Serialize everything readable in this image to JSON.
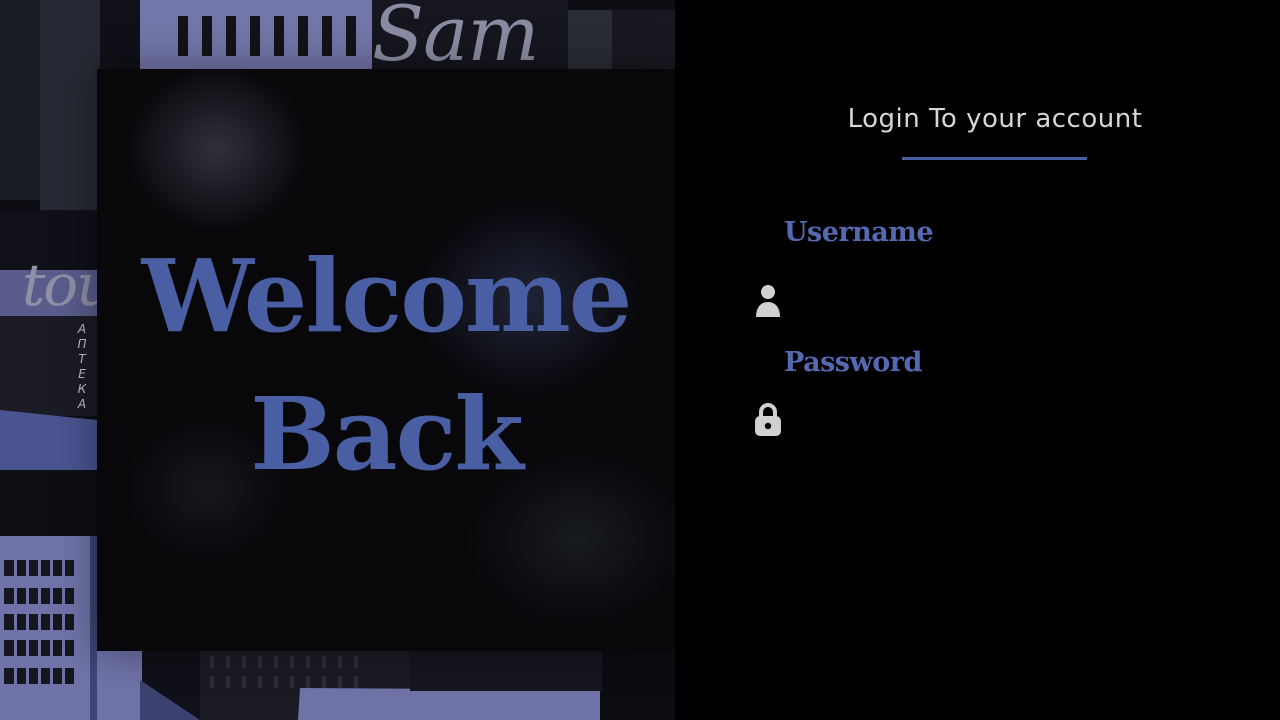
{
  "welcome": {
    "line1": "Welcome",
    "line2": "Back"
  },
  "art": {
    "tour_text": "tou",
    "sam_text": "Sam",
    "apteka_text": "АПТЕКА"
  },
  "login": {
    "heading": "Login To your account",
    "username_label": "Username",
    "username_value": "",
    "username_placeholder": "",
    "password_label": "Password",
    "password_value": "",
    "password_placeholder": ""
  },
  "icons": {
    "user": "user-icon",
    "lock": "lock-icon"
  },
  "colors": {
    "accent": "#4a5ea3",
    "label": "#5569b0",
    "heading": "#d6d6d6",
    "background": "#000000",
    "icon": "#d0d0d0"
  }
}
